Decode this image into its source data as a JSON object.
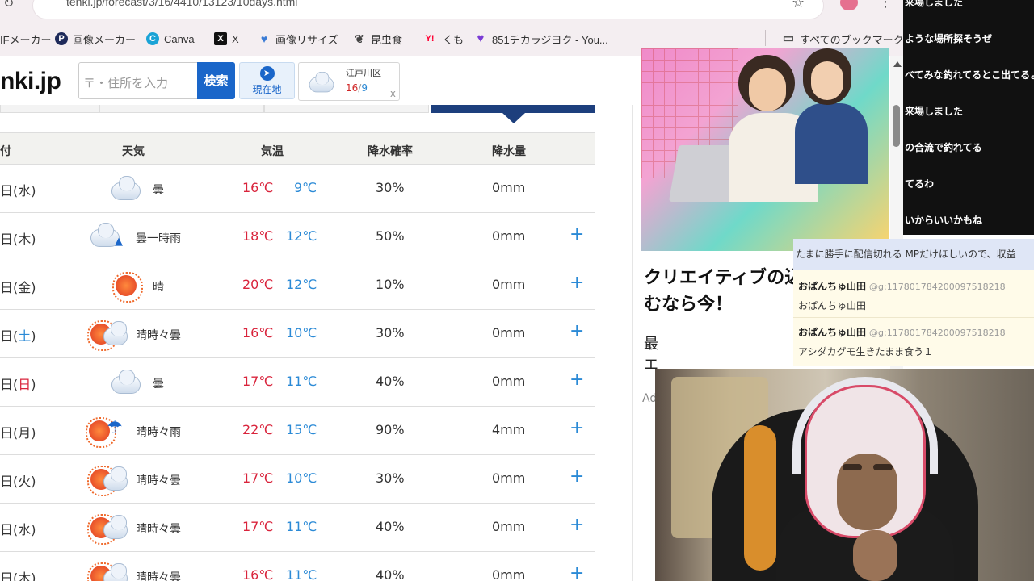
{
  "browser": {
    "url": "tenki.jp/forecast/3/16/4410/13123/10days.html",
    "bookmarks": [
      {
        "label": "IFメーカー",
        "icon": "none",
        "color": "#f4eef1"
      },
      {
        "label": "画像メーカー",
        "icon": "image-maker-icon",
        "color": "#1e2a5a"
      },
      {
        "label": "Canva",
        "icon": "canva-icon",
        "color": "#1aa3d6"
      },
      {
        "label": "X",
        "icon": "x-icon",
        "color": "#111111"
      },
      {
        "label": "画像リサイズ",
        "icon": "heart-icon",
        "color": "#3a7bd5"
      },
      {
        "label": "昆虫食",
        "icon": "bug-icon",
        "color": "#444444"
      },
      {
        "label": "くも",
        "icon": "yahoo-icon",
        "color": "#ff0033"
      },
      {
        "label": "851チカラジヨク - You...",
        "icon": "heart-icon",
        "color": "#7a3bd5"
      }
    ],
    "all_bookmarks": "すべてのブックマーク"
  },
  "site": {
    "logo": "nki.jp",
    "search_placeholder": "〒・住所を入力",
    "search_button": "検索",
    "location_button": "現在地",
    "recent": {
      "area": "江戸川区",
      "high": "16",
      "low": "9",
      "close": "x"
    }
  },
  "forecast": {
    "headers": [
      "付",
      "天気",
      "気温",
      "降水確率",
      "降水量"
    ],
    "rows": [
      {
        "date": "日(水)",
        "icon": "cloud",
        "weather": "曇",
        "high": "16℃",
        "low": "9℃",
        "pop": "30%",
        "precip": "0mm",
        "plus": ""
      },
      {
        "date": "日(木)",
        "icon": "cloud-rain",
        "weather": "曇一時雨",
        "high": "18℃",
        "low": "12℃",
        "pop": "50%",
        "precip": "0mm",
        "plus": "+"
      },
      {
        "date": "日(金)",
        "icon": "sun",
        "weather": "晴",
        "high": "20℃",
        "low": "12℃",
        "pop": "10%",
        "precip": "0mm",
        "plus": "+"
      },
      {
        "date": "日(土)",
        "icon": "sun-cloud",
        "weather": "晴時々曇",
        "high": "16℃",
        "low": "10℃",
        "pop": "30%",
        "precip": "0mm",
        "plus": "+"
      },
      {
        "date": "日(日)",
        "icon": "cloud",
        "weather": "曇",
        "high": "17℃",
        "low": "11℃",
        "pop": "40%",
        "precip": "0mm",
        "plus": "+"
      },
      {
        "date": "日(月)",
        "icon": "sun-umbrella",
        "weather": "晴時々雨",
        "high": "22℃",
        "low": "15℃",
        "pop": "90%",
        "precip": "4mm",
        "plus": "+"
      },
      {
        "date": "日(火)",
        "icon": "sun-cloud",
        "weather": "晴時々曇",
        "high": "17℃",
        "low": "10℃",
        "pop": "30%",
        "precip": "0mm",
        "plus": "+"
      },
      {
        "date": "日(水)",
        "icon": "sun-cloud",
        "weather": "晴時々曇",
        "high": "17℃",
        "low": "11℃",
        "pop": "40%",
        "precip": "0mm",
        "plus": "+"
      },
      {
        "date": "日(木)",
        "icon": "sun-cloud",
        "weather": "晴時々曇",
        "high": "16℃",
        "low": "11℃",
        "pop": "40%",
        "precip": "0mm",
        "plus": "+"
      }
    ]
  },
  "ad": {
    "title": "クリエイティブの込むなら今！",
    "sub": "最エ",
    "ad_label": "Ad"
  },
  "stream_chat": {
    "dark_lines": [
      "来場しました",
      "ような場所探そうぜ",
      "べてみな釣れてるとこ出てるよ",
      "来場しました",
      "の合流で釣れてる",
      "てるわ",
      "いからいいかもね"
    ],
    "top_bar": "たまに勝手に配信切れる MPだけほしいので、収益",
    "messages": [
      {
        "name": "おぱんちゅ山田",
        "id": "@g:117801784200097518218",
        "text": "おぱんちゅ山田"
      },
      {
        "name": "おぱんちゅ山田",
        "id": "@g:117801784200097518218",
        "text": "アシダカグモ生きたまま食う１"
      }
    ]
  },
  "colors": {
    "accent": "#1a66c9",
    "high_temp": "#d9243c",
    "low_temp": "#2b8ad6",
    "tab_active": "#1d3f7d"
  }
}
